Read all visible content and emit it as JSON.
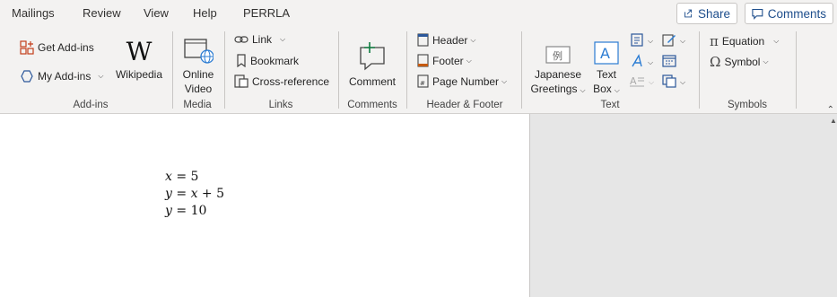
{
  "tabs": [
    "Mailings",
    "Review",
    "View",
    "Help",
    "PERRLA"
  ],
  "share_label": "Share",
  "comments_label": "Comments",
  "groups": {
    "addins": {
      "label": "Add-ins",
      "get_addins": "Get Add-ins",
      "my_addins": "My Add-ins",
      "wikipedia": "Wikipedia"
    },
    "media": {
      "label": "Media",
      "online_video_l1": "Online",
      "online_video_l2": "Video"
    },
    "links": {
      "label": "Links",
      "link": "Link",
      "bookmark": "Bookmark",
      "cross_reference": "Cross-reference"
    },
    "comments": {
      "label": "Comments",
      "comment": "Comment"
    },
    "header_footer": {
      "label": "Header & Footer",
      "header": "Header",
      "footer": "Footer",
      "page_number": "Page Number"
    },
    "text": {
      "label": "Text",
      "japanese_l1": "Japanese",
      "japanese_l2": "Greetings",
      "textbox_l1": "Text",
      "textbox_l2": "Box"
    },
    "symbols": {
      "label": "Symbols",
      "equation": "Equation",
      "symbol": "Symbol"
    }
  },
  "document": {
    "equations": [
      {
        "lhs": "x",
        "rhs": "5"
      },
      {
        "lhs": "y",
        "rhs_var": "x",
        "rhs": "+ 5"
      },
      {
        "lhs": "y",
        "rhs": "10"
      }
    ]
  },
  "colors": {
    "accent": "#2b579a",
    "share_text": "#1e4e8c"
  }
}
